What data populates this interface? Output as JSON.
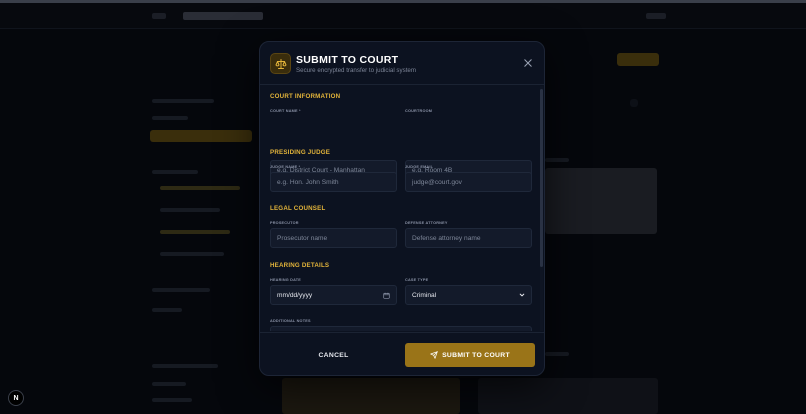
{
  "modal": {
    "title": "SUBMIT TO COURT",
    "subtitle": "Secure encrypted transfer to judicial system",
    "header_icon": "scales-of-justice-icon",
    "close_icon": "close-icon"
  },
  "sections": {
    "court": {
      "title": "COURT INFORMATION",
      "court_name_label": "COURT NAME *",
      "court_name_placeholder": "e.g. District Court - Manhattan",
      "courtroom_label": "COURTROOM",
      "courtroom_placeholder": "e.g. Room 4B"
    },
    "judge": {
      "title": "PRESIDING JUDGE",
      "judge_name_label": "JUDGE NAME *",
      "judge_name_placeholder": "e.g. Hon. John Smith",
      "judge_email_label": "JUDGE EMAIL",
      "judge_email_placeholder": "judge@court.gov"
    },
    "counsel": {
      "title": "LEGAL COUNSEL",
      "prosecutor_label": "PROSECUTOR",
      "prosecutor_placeholder": "Prosecutor name",
      "defense_label": "DEFENSE ATTORNEY",
      "defense_placeholder": "Defense attorney name"
    },
    "hearing": {
      "title": "HEARING DETAILS",
      "date_label": "HEARING DATE",
      "date_placeholder": "mm/dd/yyyy",
      "case_type_label": "CASE TYPE",
      "case_type_value": "Criminal",
      "notes_label": "ADDITIONAL NOTES"
    }
  },
  "footer": {
    "cancel_label": "CANCEL",
    "submit_label": "SUBMIT TO COURT",
    "submit_icon": "send-icon"
  },
  "badge": {
    "label": "N"
  },
  "colors": {
    "accent": "#e3b43a",
    "submit": "#9a7418",
    "modal_bg": "#0c1220",
    "input_bg": "#131a2a"
  }
}
